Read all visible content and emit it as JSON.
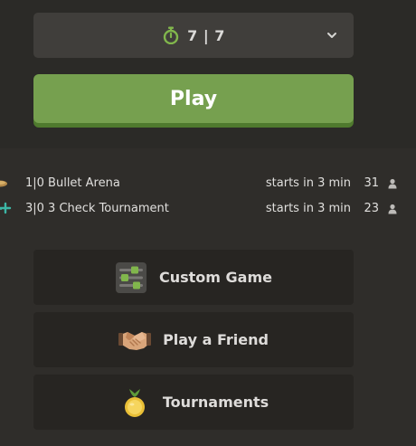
{
  "time_control": {
    "label": "7 | 7",
    "timer_icon": "stopwatch-icon",
    "dropdown_icon": "chevron-down-icon"
  },
  "play_button": {
    "label": "Play",
    "color": "#76a04f"
  },
  "events": [
    {
      "icon": "bullet-arena-icon",
      "name": "1|0 Bullet Arena",
      "start": "starts in 3 min",
      "count": "31",
      "count_icon": "user-icon"
    },
    {
      "icon": "three-check-icon",
      "name": "3|0 3 Check Tournament",
      "start": "starts in 3 min",
      "count": "23",
      "count_icon": "user-icon"
    }
  ],
  "menu": [
    {
      "label": "Custom Game",
      "icon": "sliders-icon"
    },
    {
      "label": "Play a Friend",
      "icon": "handshake-icon"
    },
    {
      "label": "Tournaments",
      "icon": "trophy-medal-icon"
    }
  ]
}
